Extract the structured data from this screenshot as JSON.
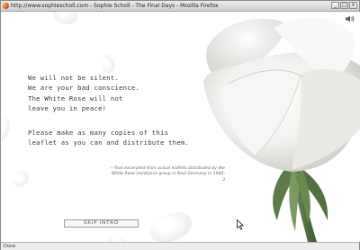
{
  "window": {
    "title": "http://www.sophiescholl.com - Sophie Scholl - The Final Days - Mozilla Firefox",
    "buttons": {
      "minimize": "_",
      "maximize": "□",
      "close": "×"
    }
  },
  "content": {
    "quote_lines_1": "We will not be silent.\nWe are your bad conscience.\nThe White Rose will not\nleave you in peace!",
    "quote_lines_2": "Please make as many copies of this\nleaflet as you can and distribute them.",
    "attribution": "—Text excerpted from actual leaflets distributed by the White Rose resistance group in Nazi Germany in 1942-3",
    "skip_label": "SKIP INTRO",
    "speaker_icon": "speaker-icon"
  },
  "status": {
    "text": "Done"
  },
  "colors": {
    "background": "#ffffff",
    "text": "#3a3a3a",
    "titlebar": "#d9d9d9"
  }
}
